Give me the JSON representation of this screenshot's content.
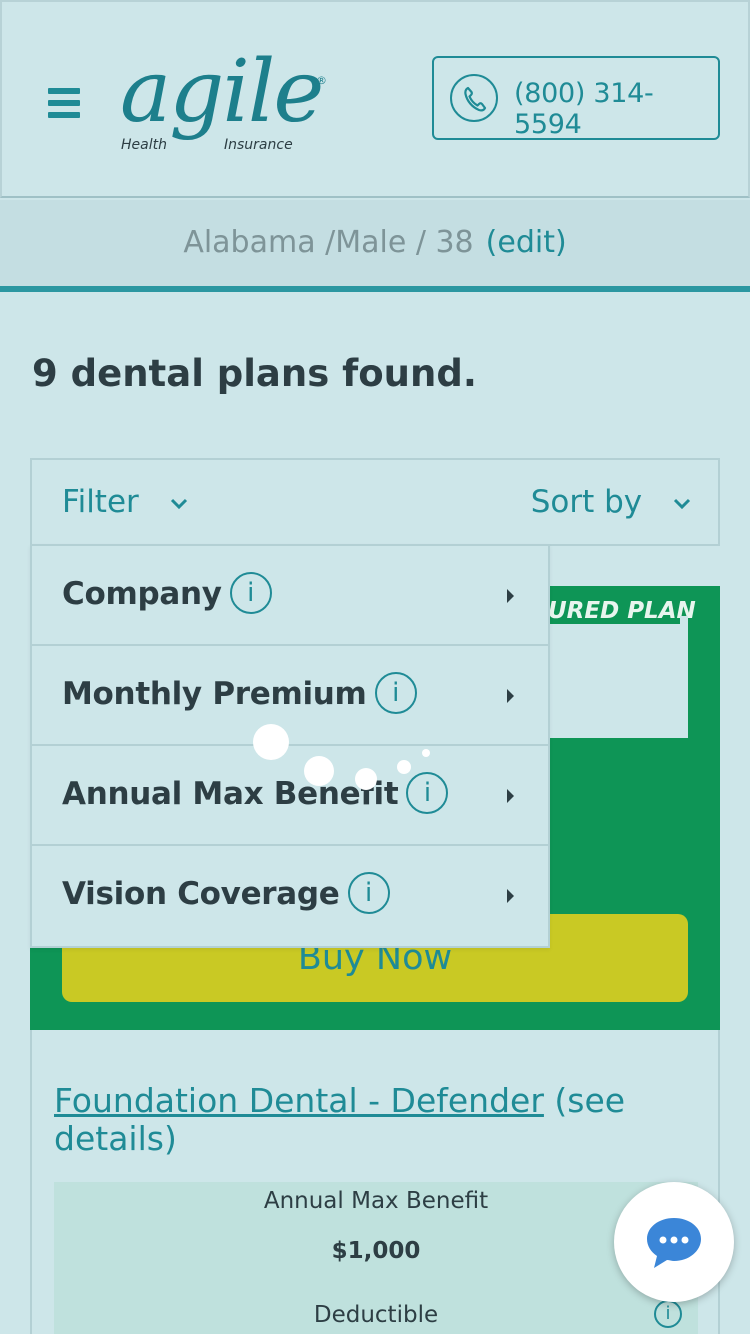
{
  "header": {
    "logo": {
      "word": "agile",
      "registered": "®",
      "sub_left": "Health",
      "sub_right": "Insurance"
    },
    "phone": "(800) 314-5594"
  },
  "info_bar": {
    "profile": "Alabama /Male / 38",
    "edit_label": "(edit)"
  },
  "results": {
    "count_text": "9 dental plans found."
  },
  "toolbar": {
    "filter_label": "Filter",
    "sort_label": "Sort by"
  },
  "filter_menu": {
    "items": [
      {
        "label": "Company"
      },
      {
        "label": "Monthly Premium"
      },
      {
        "label": "Annual Max Benefit"
      },
      {
        "label": "Vision Coverage"
      }
    ],
    "info_glyph": "i"
  },
  "featured": {
    "label": "URED PLAN",
    "buy_label": "Buy Now"
  },
  "plan": {
    "name": "Foundation Dental - Defender",
    "details_link": "(see details)",
    "annual_max_label": "Annual Max Benefit",
    "annual_max_value": "$1,000",
    "deductible_label": "Deductible",
    "info_glyph": "i"
  },
  "colors": {
    "background": "#cde6e9",
    "accent_teal": "#1f8b96",
    "featured_green": "#0e9556",
    "buy_yellow": "#c9c924",
    "text_dark": "#2d3e44"
  },
  "icons": {
    "menu": "hamburger-icon",
    "phone": "phone-icon",
    "chevron": "chevron-down-icon",
    "submenu": "caret-right-icon",
    "chat": "chat-icon"
  }
}
